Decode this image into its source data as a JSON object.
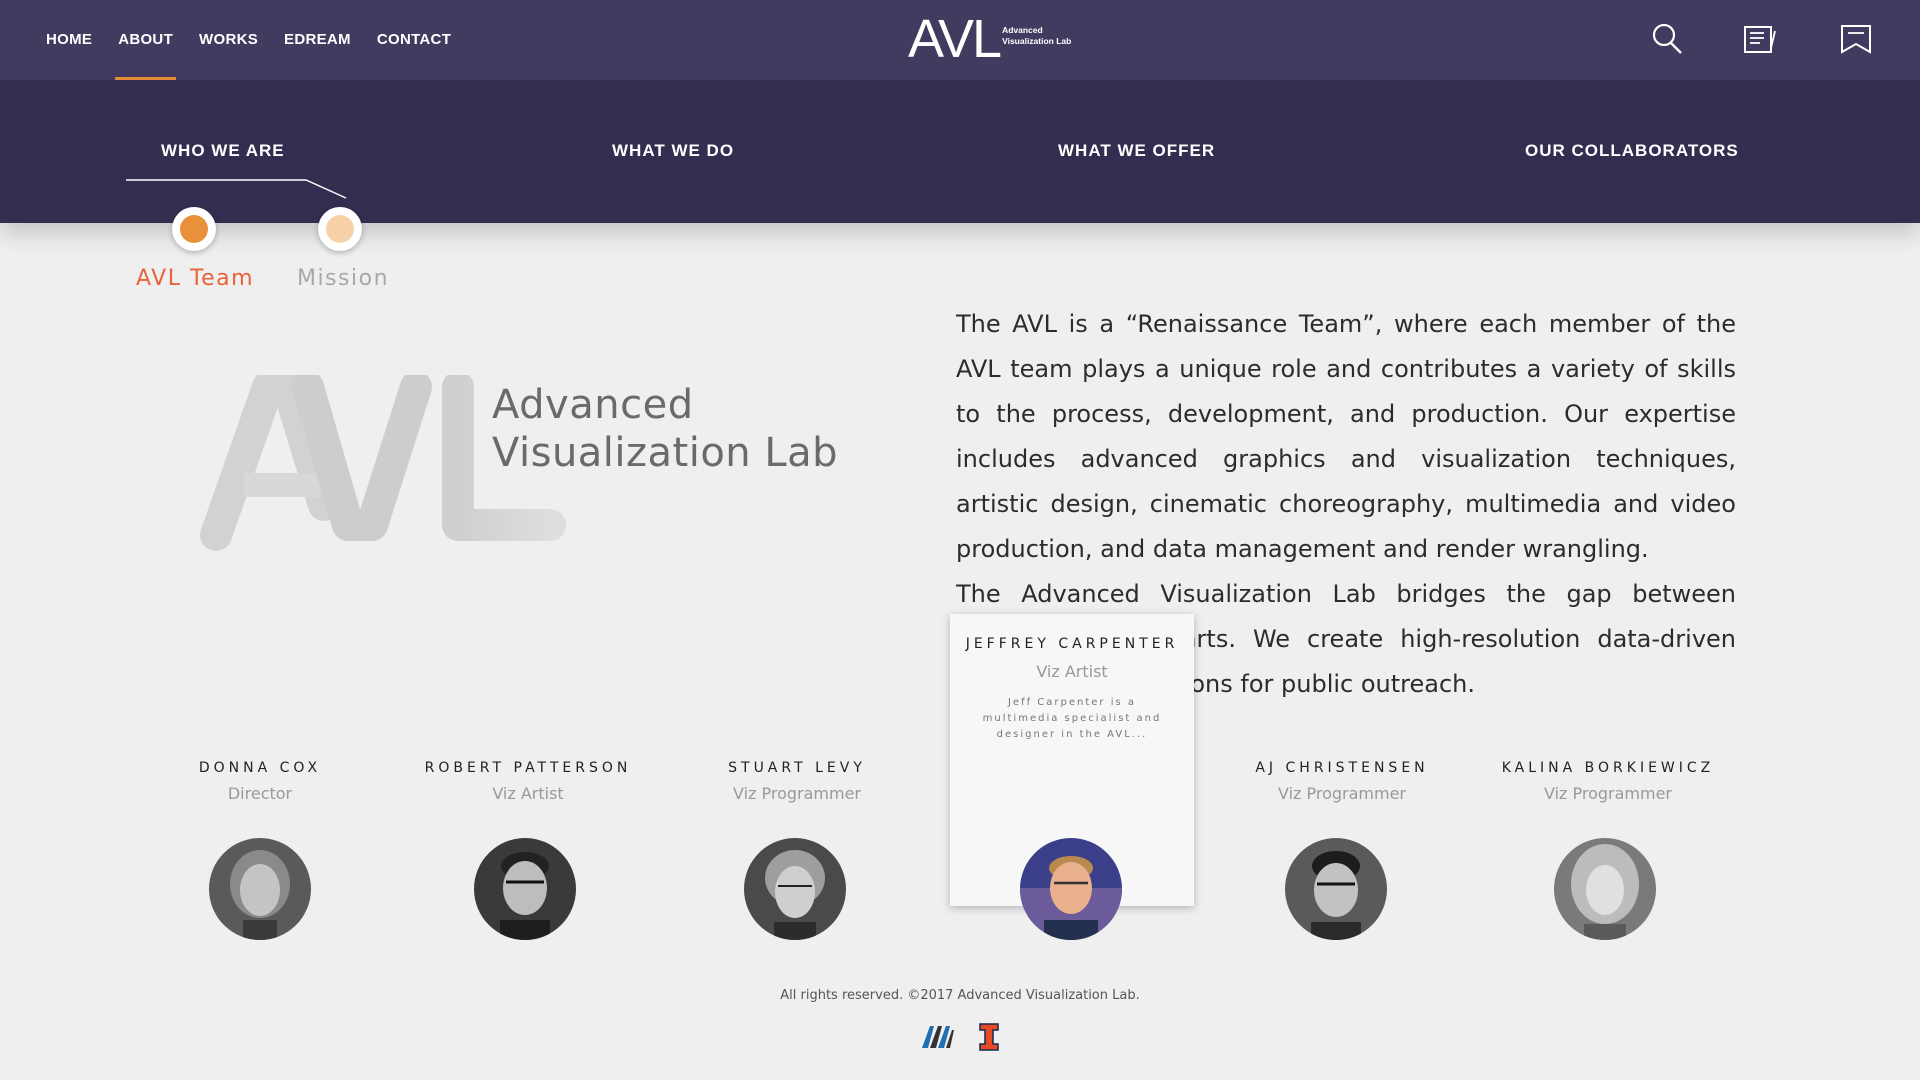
{
  "nav": {
    "items": [
      {
        "label": "HOME",
        "active": false
      },
      {
        "label": "ABOUT",
        "active": true
      },
      {
        "label": "WORKS",
        "active": false
      },
      {
        "label": "EDREAM",
        "active": false
      },
      {
        "label": "CONTACT",
        "active": false
      }
    ],
    "accent_color": "#e8903a"
  },
  "logo": {
    "mark": "AVL",
    "sub_line1": "Advanced",
    "sub_line2": "Visualization Lab"
  },
  "header_icons": [
    "search-icon",
    "notes-icon",
    "bookmark-icon"
  ],
  "sections": {
    "tabs": [
      "WHO WE ARE",
      "WHAT WE DO",
      "WHAT WE OFFER",
      "OUR COLLABORATORS"
    ],
    "active": "WHO WE ARE"
  },
  "subsections": {
    "items": [
      {
        "label": "AVL Team",
        "active": true,
        "color": "#e8903a"
      },
      {
        "label": "Mission",
        "active": false,
        "color": "#f7d2a8"
      }
    ]
  },
  "hero_logo": {
    "mark": "AVL",
    "line1": "Advanced",
    "line2": "Visualization Lab"
  },
  "description": {
    "p1": "The AVL is a “Renaissance Team”, where each member of the AVL team plays a unique role and contributes a variety of skills to the process, development, and production.  Our expertise includes advanced graphics and visualization techniques, artistic design, cinematic choreography, multimedia and video production, and data management and render wrangling.",
    "p2": "The Advanced Visualization Lab bridges the gap between science and the arts. We create high-resolution data-driven scientific visualizations for public outreach."
  },
  "team": [
    {
      "name": "DONNA COX",
      "role": "Director"
    },
    {
      "name": "ROBERT PATTERSON",
      "role": "Viz Artist"
    },
    {
      "name": "STUART LEVY",
      "role": "Viz Programmer"
    },
    {
      "name": "JEFFREY CARPENTER",
      "role": "Viz Artist"
    },
    {
      "name": "AJ CHRISTENSEN",
      "role": "Viz Programmer"
    },
    {
      "name": "KALINA BORKIEWICZ",
      "role": "Viz Programmer"
    }
  ],
  "hover_card": {
    "name": "JEFFREY CARPENTER",
    "role": "Viz Artist",
    "bio": "Jeff Carpenter is a multimedia specialist and designer in the AVL..."
  },
  "footer": {
    "copyright": "All rights reserved. ©2017 Advanced Visualization Lab.",
    "logos": [
      "ncsa-logo",
      "illinois-logo"
    ]
  }
}
